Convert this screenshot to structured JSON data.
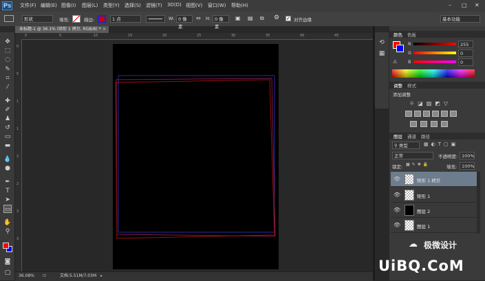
{
  "app": {
    "logo_text": "Ps",
    "window_controls": [
      "–",
      "□",
      "✕"
    ]
  },
  "menu": [
    "文件(F)",
    "编辑(E)",
    "图像(I)",
    "图层(L)",
    "类型(Y)",
    "选择(S)",
    "滤镜(T)",
    "3D(D)",
    "视图(V)",
    "窗口(W)",
    "帮助(H)"
  ],
  "options": {
    "shape_mode": "形状",
    "fill_label": "填充:",
    "stroke_label": "描边:",
    "stroke_width": "1 点",
    "w_label": "W:",
    "w_value": "0 像素",
    "h_label": "H:",
    "h_value": "0 像素",
    "align_edges_label": "对齐边缘",
    "workspace": "基本功能"
  },
  "document": {
    "tab_title": "未标题-1 @ 36.1% (矩形 1 拷贝, RGB/8) *",
    "ruler_top": [
      "0",
      "5",
      "10",
      "15",
      "20",
      "25",
      "30",
      "35",
      "40",
      "45"
    ],
    "ruler_left": [
      "0",
      "5",
      "1",
      "1",
      "2",
      "2",
      "3",
      "3"
    ],
    "zoom": "36.08%",
    "doc_info": "文档:5.51M/7.03M"
  },
  "color_panel": {
    "tabs": [
      "颜色",
      "色板"
    ],
    "r_label": "R",
    "g_label": "G",
    "b_label": "B",
    "r_value": "255",
    "g_value": "0",
    "b_value": "0",
    "fg_color": "#ff0000",
    "bg_color": "#0000ff"
  },
  "adjust_panel": {
    "tabs": [
      "调整",
      "样式"
    ],
    "title": "添加调整"
  },
  "layers_panel": {
    "tabs": [
      "图层",
      "通道",
      "路径"
    ],
    "filter_kind": "类型",
    "blend_mode": "正常",
    "opacity_label": "不透明度:",
    "opacity_value": "100%",
    "lock_label": "锁定:",
    "fill_label": "填充:",
    "fill_value": "100%",
    "layers": [
      {
        "name": "矩形 1 拷贝",
        "thumb": "transparent",
        "selected": true
      },
      {
        "name": "矩形 1",
        "thumb": "transparent",
        "selected": false
      },
      {
        "name": "图层 2",
        "thumb": "black",
        "selected": false
      },
      {
        "name": "图层 1",
        "thumb": "transparent",
        "selected": false
      }
    ]
  },
  "watermark": {
    "line1": "极微设计",
    "line2": "UiBQ.CoM"
  }
}
